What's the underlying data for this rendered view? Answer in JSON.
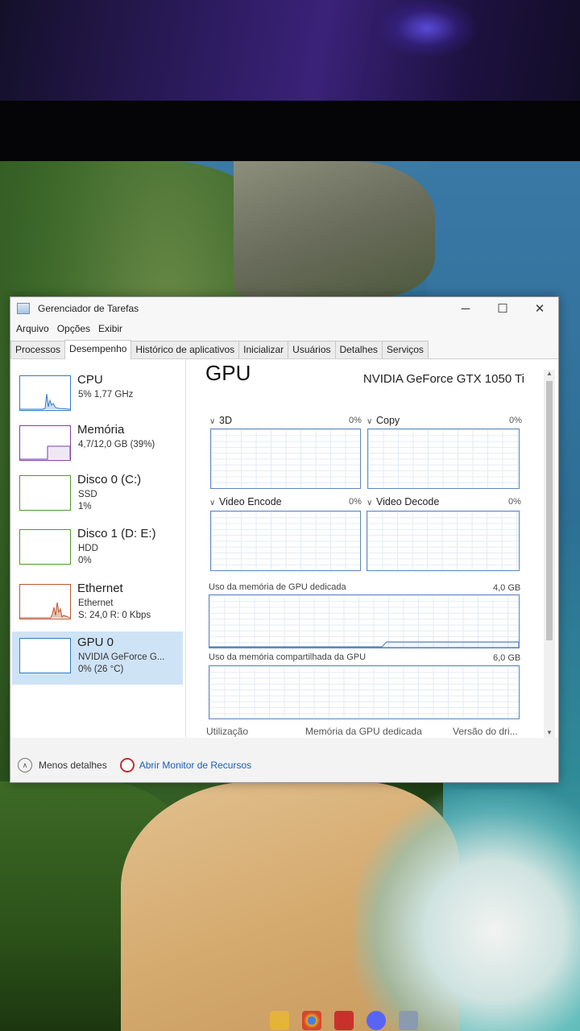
{
  "window": {
    "title": "Gerenciador de Tarefas",
    "controls": {
      "minimize": "─",
      "maximize": "☐",
      "close": "✕"
    }
  },
  "menu": [
    "Arquivo",
    "Opções",
    "Exibir"
  ],
  "tabs": [
    {
      "label": "Processos",
      "active": false
    },
    {
      "label": "Desempenho",
      "active": true
    },
    {
      "label": "Histórico de aplicativos",
      "active": false
    },
    {
      "label": "Inicializar",
      "active": false
    },
    {
      "label": "Usuários",
      "active": false
    },
    {
      "label": "Detalhes",
      "active": false
    },
    {
      "label": "Serviços",
      "active": false
    }
  ],
  "sidebar": [
    {
      "name": "CPU",
      "line1": "5% 1,77 GHz",
      "line2": "",
      "color": "#2f7bc9"
    },
    {
      "name": "Memória",
      "line1": "4,7/12,0 GB (39%)",
      "line2": "",
      "color": "#7d3fa6"
    },
    {
      "name": "Disco 0 (C:)",
      "line1": "SSD",
      "line2": "1%",
      "color": "#4c9a2a"
    },
    {
      "name": "Disco 1 (D: E:)",
      "line1": "HDD",
      "line2": "0%",
      "color": "#4c9a2a"
    },
    {
      "name": "Ethernet",
      "line1": "Ethernet",
      "line2": "S: 24,0 R: 0 Kbps",
      "color": "#b8572f"
    },
    {
      "name": "GPU 0",
      "line1": "NVIDIA GeForce G...",
      "line2": "0% (26 °C)",
      "color": "#2f7bc9"
    }
  ],
  "gpu": {
    "title": "GPU",
    "model": "NVIDIA GeForce GTX 1050 Ti",
    "engines": [
      {
        "label": "3D",
        "percent": "0%"
      },
      {
        "label": "Copy",
        "percent": "0%"
      },
      {
        "label": "Video Encode",
        "percent": "0%"
      },
      {
        "label": "Video Decode",
        "percent": "0%"
      }
    ],
    "dedicated": {
      "label": "Uso da memória de GPU dedicada",
      "max": "4,0 GB"
    },
    "shared": {
      "label": "Uso da memória compartilhada da GPU",
      "max": "6,0 GB"
    },
    "footer": [
      "Utilização",
      "Memória da GPU dedicada",
      "Versão do dri..."
    ]
  },
  "bottom": {
    "fewer_details": "Menos detalhes",
    "resource_monitor": "Abrir Monitor de Recursos"
  },
  "icons": {
    "scroll_up": "▲",
    "scroll_down": "▼",
    "collapse": "∧",
    "chevron": "∨"
  }
}
